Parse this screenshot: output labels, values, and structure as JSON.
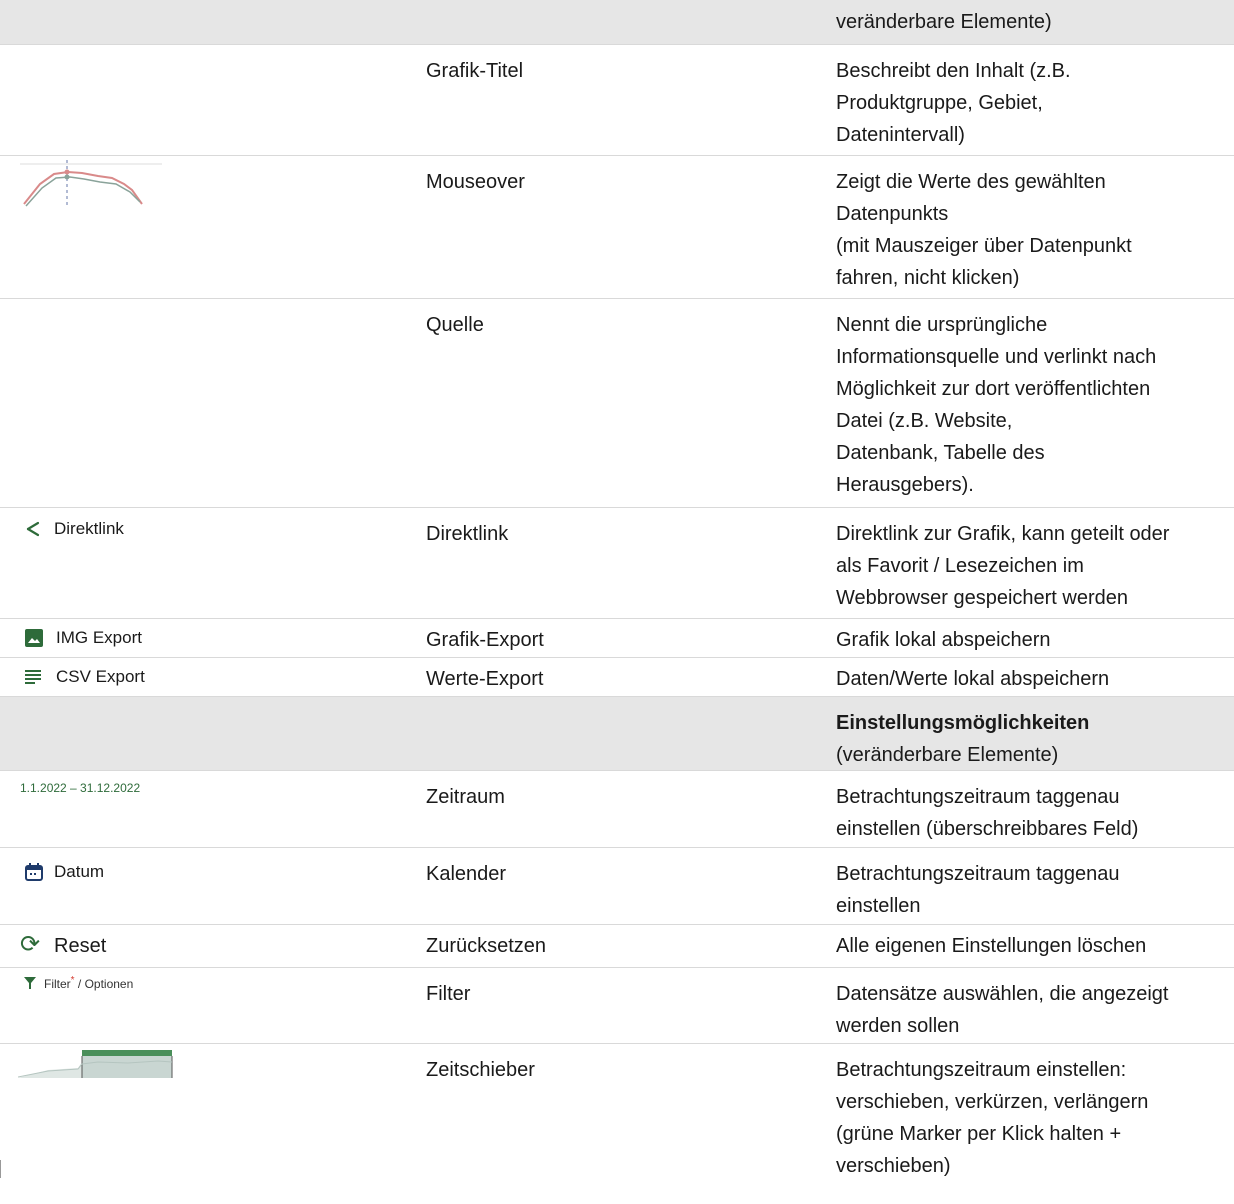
{
  "rows": {
    "r0": {
      "desc": [
        "veränderbare Elemente)"
      ]
    },
    "r1": {
      "icon_label": "",
      "name": "Grafik-Titel",
      "desc": [
        "Beschreibt den Inhalt (z.B.",
        "Produktgruppe, Gebiet,",
        "Datenintervall)"
      ]
    },
    "r2": {
      "icon_name": "mouseover-line-chart-thumbnail",
      "name": "Mouseover",
      "desc": [
        "Zeigt die Werte des gewählten",
        "Datenpunkts",
        "(mit Mauszeiger über Datenpunkt",
        "fahren, nicht klicken)"
      ]
    },
    "r3": {
      "name": "Quelle",
      "desc": [
        "Nennt die ursprüngliche",
        "Informationsquelle und verlinkt nach",
        "Möglichkeit zur dort veröffentlichten",
        "Datei (z.B. Website,",
        "Datenbank, Tabelle des",
        "Herausgebers)."
      ]
    },
    "r4": {
      "icon_name": "share-icon",
      "icon_label": "Direktlink",
      "name": "Direktlink",
      "desc": [
        "Direktlink zur Grafik, kann geteilt oder",
        "als Favorit / Lesezeichen im",
        "Webbrowser gespeichert werden"
      ]
    },
    "r5": {
      "icon_name": "image-icon",
      "icon_label": "IMG Export",
      "name": "Grafik-Export",
      "desc": [
        "Grafik lokal abspeichern"
      ]
    },
    "r6": {
      "icon_name": "list-icon",
      "icon_label": "CSV Export",
      "name": "Werte-Export",
      "desc": [
        "Daten/Werte lokal abspeichern"
      ]
    },
    "r7": {
      "desc_bold": "Einstellungsmöglichkeiten",
      "desc": [
        "(veränderbare Elemente)"
      ]
    },
    "r8": {
      "icon_label": "1.1.2022 – 31.12.2022",
      "name": "Zeitraum",
      "desc": [
        "Betrachtungszeitraum taggenau",
        "einstellen (überschreibbares Feld)"
      ]
    },
    "r9": {
      "icon_name": "calendar-icon",
      "icon_label": "Datum",
      "name": "Kalender",
      "desc": [
        "Betrachtungszeitraum taggenau",
        "einstellen"
      ]
    },
    "r10": {
      "icon_name": "refresh-icon",
      "icon_label": "Reset",
      "name": "Zurücksetzen",
      "desc": [
        "Alle eigenen Einstellungen löschen"
      ]
    },
    "r11": {
      "icon_name": "filter-icon",
      "icon_label_a": "Filter",
      "icon_label_star": "*",
      "icon_label_b": " / Optionen",
      "name": "Filter",
      "desc": [
        "Datensätze auswählen, die angezeigt",
        "werden sollen"
      ]
    },
    "r12": {
      "icon_name": "time-slider-thumbnail",
      "name": "Zeitschieber",
      "desc": [
        "Betrachtungszeitraum einstellen:",
        "verschieben, verkürzen, verlängern",
        "(grüne Marker per Klick halten +",
        "verschieben)"
      ]
    }
  },
  "colors": {
    "header_bg": "#e6e6e6",
    "accent_green": "#2e6b3a",
    "asterisk_red": "#d43a2f"
  }
}
